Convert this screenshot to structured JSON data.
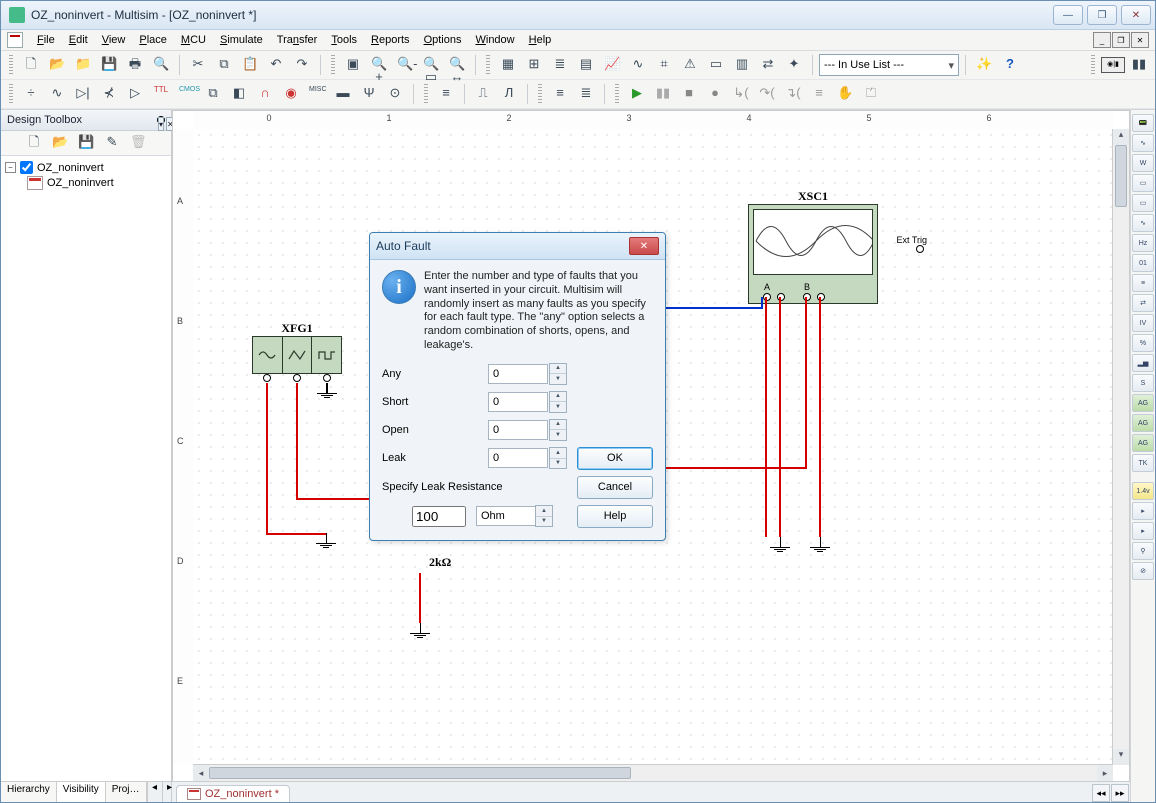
{
  "title": "OZ_noninvert - Multisim - [OZ_noninvert *]",
  "menus": [
    "File",
    "Edit",
    "View",
    "Place",
    "MCU",
    "Simulate",
    "Transfer",
    "Tools",
    "Reports",
    "Options",
    "Window",
    "Help"
  ],
  "inUseList": "--- In Use List ---",
  "leftPanel": {
    "title": "Design Toolbox",
    "root": "OZ_noninvert",
    "child": "OZ_noninvert",
    "tabs": [
      "Hierarchy",
      "Visibility",
      "Projects"
    ]
  },
  "docTab": "OZ_noninvert *",
  "rulerH": [
    "0",
    "1",
    "2",
    "3",
    "4",
    "5",
    "6"
  ],
  "rulerV": [
    "A",
    "B",
    "C",
    "D",
    "E"
  ],
  "components": {
    "xfgLabel": "XFG1",
    "xfgTerms": [
      "+",
      "−",
      "⏚"
    ],
    "scopeLabel": "XSC1",
    "scopeChA": "A",
    "scopeChB": "B",
    "scopeExt": "Ext Trig",
    "r2Value": "2kΩ"
  },
  "dialog": {
    "title": "Auto Fault",
    "infoText": "Enter the number and type of faults that you want inserted in your circuit. Multisim will randomly insert as many faults as you specify for each fault type. The \"any\" option selects a random combination of shorts, opens, and leakage's.",
    "rows": {
      "any": {
        "label": "Any",
        "value": "0"
      },
      "short": {
        "label": "Short",
        "value": "0"
      },
      "open": {
        "label": "Open",
        "value": "0"
      },
      "leak": {
        "label": "Leak",
        "value": "0"
      }
    },
    "leakResLabel": "Specify Leak Resistance",
    "leakResValue": "100",
    "leakResUnit": "Ohm",
    "buttons": {
      "ok": "OK",
      "cancel": "Cancel",
      "help": "Help"
    }
  }
}
